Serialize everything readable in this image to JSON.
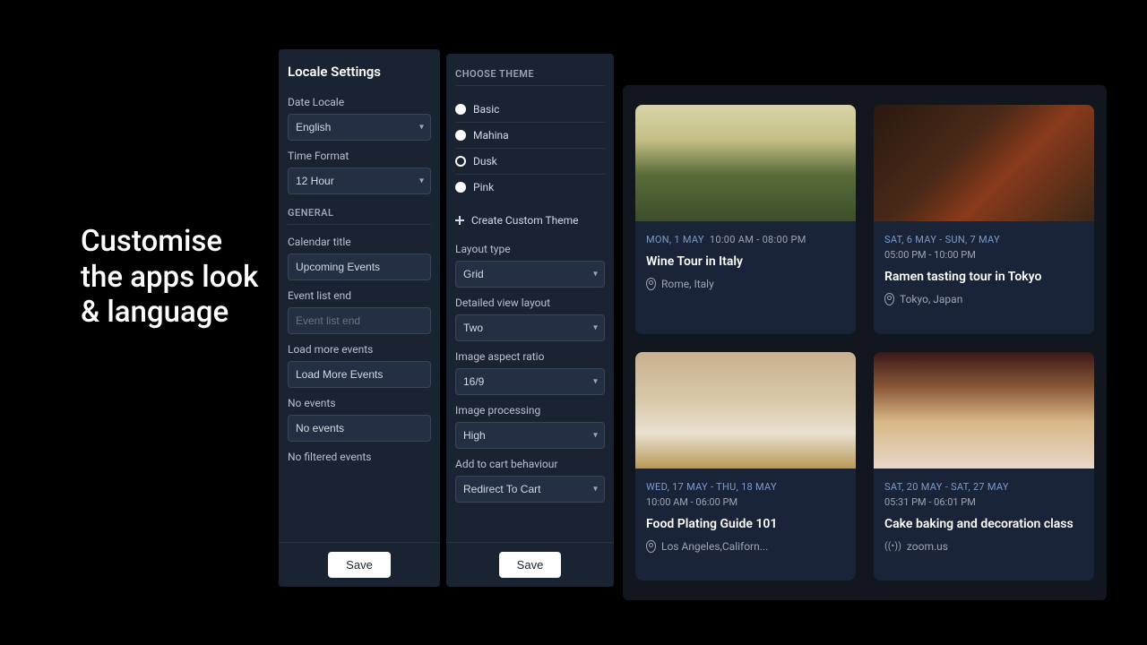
{
  "hero": "Customise the apps look & language",
  "panel1": {
    "title": "Locale Settings",
    "dateLocaleLabel": "Date Locale",
    "dateLocaleValue": "English",
    "timeFormatLabel": "Time Format",
    "timeFormatValue": "12 Hour",
    "generalHeader": "GENERAL",
    "calendarTitleLabel": "Calendar title",
    "calendarTitleValue": "Upcoming Events",
    "eventListEndLabel": "Event list end",
    "eventListEndPlaceholder": "Event list end",
    "loadMoreLabel": "Load more events",
    "loadMoreValue": "Load More Events",
    "noEventsLabel": "No events",
    "noEventsValue": "No events",
    "noFilteredLabel": "No filtered events",
    "saveLabel": "Save"
  },
  "panel2": {
    "chooseThemeHeader": "CHOOSE THEME",
    "themes": [
      {
        "name": "Basic",
        "selected": false
      },
      {
        "name": "Mahina",
        "selected": false
      },
      {
        "name": "Dusk",
        "selected": true
      },
      {
        "name": "Pink",
        "selected": false
      }
    ],
    "createThemeLabel": "Create Custom Theme",
    "layoutTypeLabel": "Layout type",
    "layoutTypeValue": "Grid",
    "detailedViewLabel": "Detailed view layout",
    "detailedViewValue": "Two",
    "aspectRatioLabel": "Image aspect ratio",
    "aspectRatioValue": "16/9",
    "imageProcessingLabel": "Image processing",
    "imageProcessingValue": "High",
    "addToCartLabel": "Add to cart behaviour",
    "addToCartValue": "Redirect To Cart",
    "saveLabel": "Save"
  },
  "cards": [
    {
      "date": "MON, 1 MAY",
      "time": "10:00 AM - 08:00 PM",
      "dateInline": true,
      "title": "Wine Tour in Italy",
      "loc": "Rome, Italy",
      "locType": "pin"
    },
    {
      "date": "SAT, 6 MAY - SUN, 7 MAY",
      "time": "05:00 PM - 10:00 PM",
      "dateInline": false,
      "title": "Ramen tasting tour in Tokyo",
      "loc": "Tokyo, Japan",
      "locType": "pin"
    },
    {
      "date": "WED, 17 MAY - THU, 18 MAY",
      "time": "10:00 AM - 06:00 PM",
      "dateInline": false,
      "title": "Food Plating Guide 101",
      "loc": "Los Angeles,Californ...",
      "locType": "pin"
    },
    {
      "date": "SAT, 20 MAY - SAT, 27 MAY",
      "time": "05:31 PM - 06:01 PM",
      "dateInline": false,
      "title": "Cake baking and decoration class",
      "loc": "zoom.us",
      "locType": "online"
    }
  ]
}
